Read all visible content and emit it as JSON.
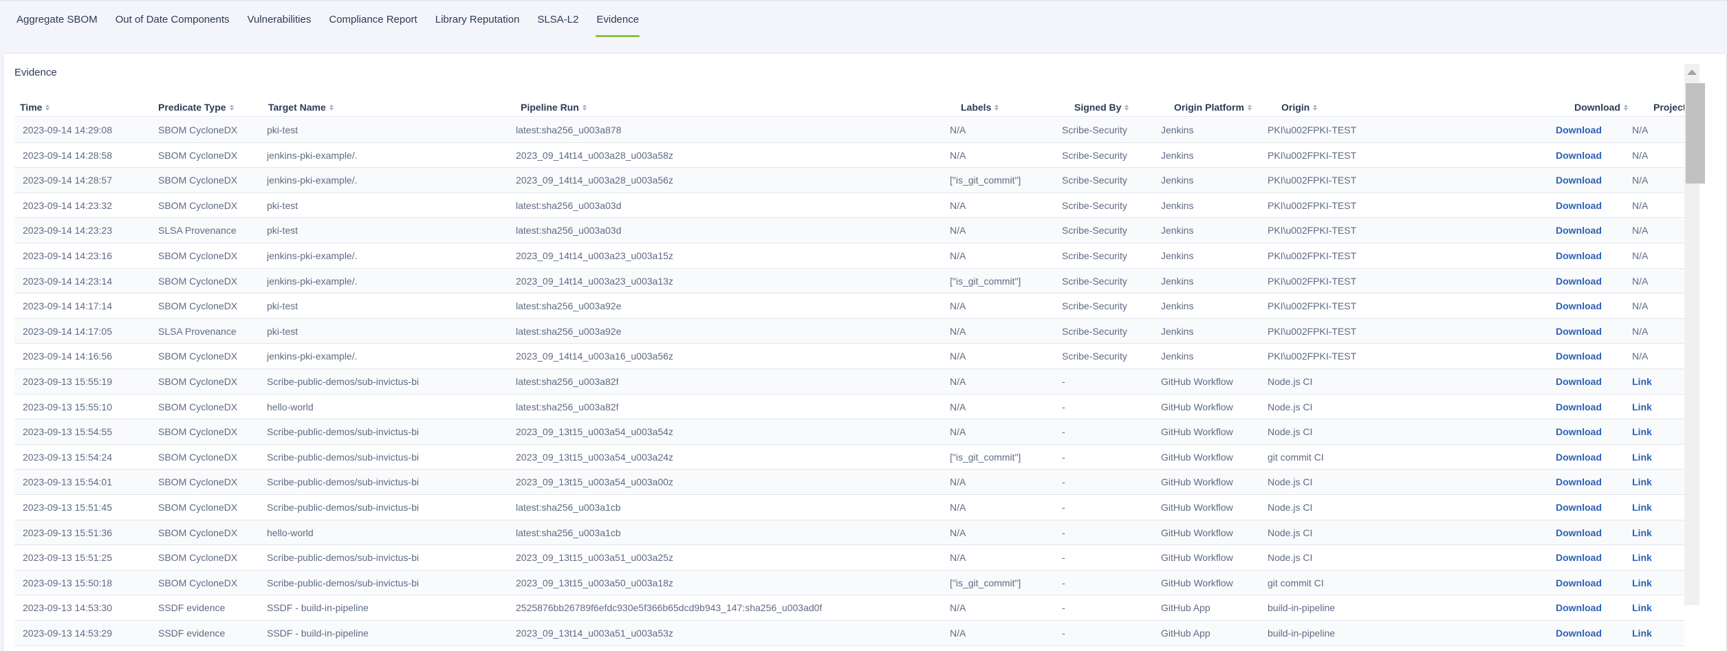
{
  "tabs": [
    {
      "label": "Aggregate SBOM",
      "active": false
    },
    {
      "label": "Out of Date Components",
      "active": false
    },
    {
      "label": "Vulnerabilities",
      "active": false
    },
    {
      "label": "Compliance Report",
      "active": false
    },
    {
      "label": "Library Reputation",
      "active": false
    },
    {
      "label": "SLSA-L2",
      "active": false
    },
    {
      "label": "Evidence",
      "active": true
    }
  ],
  "colors": {
    "accent": "#8cbf3f",
    "link": "#2a62b8"
  },
  "evidence": {
    "title": "Evidence",
    "columns": [
      {
        "key": "time",
        "label": "Time"
      },
      {
        "key": "predicate",
        "label": "Predicate Type"
      },
      {
        "key": "target",
        "label": "Target Name"
      },
      {
        "key": "pipeline",
        "label": "Pipeline Run"
      },
      {
        "key": "labels",
        "label": "Labels"
      },
      {
        "key": "signed",
        "label": "Signed By"
      },
      {
        "key": "platform",
        "label": "Origin Platform"
      },
      {
        "key": "origin",
        "label": "Origin"
      },
      {
        "key": "download",
        "label": "Download"
      },
      {
        "key": "project",
        "label": "Project"
      }
    ],
    "rows": [
      {
        "time": "2023-09-14 14:29:08",
        "predicate": "SBOM CycloneDX",
        "target": "pki-test",
        "pipeline": "latest:sha256_u003a878",
        "labels": "N/A",
        "signed": "Scribe-Security",
        "platform": "Jenkins",
        "origin": "PKI\\u002FPKI-TEST",
        "download": "Download",
        "project": "N/A"
      },
      {
        "time": "2023-09-14 14:28:58",
        "predicate": "SBOM CycloneDX",
        "target": "jenkins-pki-example/.",
        "pipeline": "2023_09_14t14_u003a28_u003a58z",
        "labels": "N/A",
        "signed": "Scribe-Security",
        "platform": "Jenkins",
        "origin": "PKI\\u002FPKI-TEST",
        "download": "Download",
        "project": "N/A"
      },
      {
        "time": "2023-09-14 14:28:57",
        "predicate": "SBOM CycloneDX",
        "target": "jenkins-pki-example/.",
        "pipeline": "2023_09_14t14_u003a28_u003a56z",
        "labels": "[\"is_git_commit\"]",
        "signed": "Scribe-Security",
        "platform": "Jenkins",
        "origin": "PKI\\u002FPKI-TEST",
        "download": "Download",
        "project": "N/A"
      },
      {
        "time": "2023-09-14 14:23:32",
        "predicate": "SBOM CycloneDX",
        "target": "pki-test",
        "pipeline": "latest:sha256_u003a03d",
        "labels": "N/A",
        "signed": "Scribe-Security",
        "platform": "Jenkins",
        "origin": "PKI\\u002FPKI-TEST",
        "download": "Download",
        "project": "N/A"
      },
      {
        "time": "2023-09-14 14:23:23",
        "predicate": "SLSA Provenance",
        "target": "pki-test",
        "pipeline": "latest:sha256_u003a03d",
        "labels": "N/A",
        "signed": "Scribe-Security",
        "platform": "Jenkins",
        "origin": "PKI\\u002FPKI-TEST",
        "download": "Download",
        "project": "N/A"
      },
      {
        "time": "2023-09-14 14:23:16",
        "predicate": "SBOM CycloneDX",
        "target": "jenkins-pki-example/.",
        "pipeline": "2023_09_14t14_u003a23_u003a15z",
        "labels": "N/A",
        "signed": "Scribe-Security",
        "platform": "Jenkins",
        "origin": "PKI\\u002FPKI-TEST",
        "download": "Download",
        "project": "N/A"
      },
      {
        "time": "2023-09-14 14:23:14",
        "predicate": "SBOM CycloneDX",
        "target": "jenkins-pki-example/.",
        "pipeline": "2023_09_14t14_u003a23_u003a13z",
        "labels": "[\"is_git_commit\"]",
        "signed": "Scribe-Security",
        "platform": "Jenkins",
        "origin": "PKI\\u002FPKI-TEST",
        "download": "Download",
        "project": "N/A"
      },
      {
        "time": "2023-09-14 14:17:14",
        "predicate": "SBOM CycloneDX",
        "target": "pki-test",
        "pipeline": "latest:sha256_u003a92e",
        "labels": "N/A",
        "signed": "Scribe-Security",
        "platform": "Jenkins",
        "origin": "PKI\\u002FPKI-TEST",
        "download": "Download",
        "project": "N/A"
      },
      {
        "time": "2023-09-14 14:17:05",
        "predicate": "SLSA Provenance",
        "target": "pki-test",
        "pipeline": "latest:sha256_u003a92e",
        "labels": "N/A",
        "signed": "Scribe-Security",
        "platform": "Jenkins",
        "origin": "PKI\\u002FPKI-TEST",
        "download": "Download",
        "project": "N/A"
      },
      {
        "time": "2023-09-14 14:16:56",
        "predicate": "SBOM CycloneDX",
        "target": "jenkins-pki-example/.",
        "pipeline": "2023_09_14t14_u003a16_u003a56z",
        "labels": "N/A",
        "signed": "Scribe-Security",
        "platform": "Jenkins",
        "origin": "PKI\\u002FPKI-TEST",
        "download": "Download",
        "project": "N/A"
      },
      {
        "time": "2023-09-13 15:55:19",
        "predicate": "SBOM CycloneDX",
        "target": "Scribe-public-demos/sub-invictus-bi",
        "pipeline": "latest:sha256_u003a82f",
        "labels": "N/A",
        "signed": "-",
        "platform": "GitHub Workflow",
        "origin": "Node.js CI",
        "download": "Download",
        "project": "Link"
      },
      {
        "time": "2023-09-13 15:55:10",
        "predicate": "SBOM CycloneDX",
        "target": "hello-world",
        "pipeline": "latest:sha256_u003a82f",
        "labels": "N/A",
        "signed": "-",
        "platform": "GitHub Workflow",
        "origin": "Node.js CI",
        "download": "Download",
        "project": "Link"
      },
      {
        "time": "2023-09-13 15:54:55",
        "predicate": "SBOM CycloneDX",
        "target": "Scribe-public-demos/sub-invictus-bi",
        "pipeline": "2023_09_13t15_u003a54_u003a54z",
        "labels": "N/A",
        "signed": "-",
        "platform": "GitHub Workflow",
        "origin": "Node.js CI",
        "download": "Download",
        "project": "Link"
      },
      {
        "time": "2023-09-13 15:54:24",
        "predicate": "SBOM CycloneDX",
        "target": "Scribe-public-demos/sub-invictus-bi",
        "pipeline": "2023_09_13t15_u003a54_u003a24z",
        "labels": "[\"is_git_commit\"]",
        "signed": "-",
        "platform": "GitHub Workflow",
        "origin": "git commit CI",
        "download": "Download",
        "project": "Link"
      },
      {
        "time": "2023-09-13 15:54:01",
        "predicate": "SBOM CycloneDX",
        "target": "Scribe-public-demos/sub-invictus-bi",
        "pipeline": "2023_09_13t15_u003a54_u003a00z",
        "labels": "N/A",
        "signed": "-",
        "platform": "GitHub Workflow",
        "origin": "Node.js CI",
        "download": "Download",
        "project": "Link"
      },
      {
        "time": "2023-09-13 15:51:45",
        "predicate": "SBOM CycloneDX",
        "target": "Scribe-public-demos/sub-invictus-bi",
        "pipeline": "latest:sha256_u003a1cb",
        "labels": "N/A",
        "signed": "-",
        "platform": "GitHub Workflow",
        "origin": "Node.js CI",
        "download": "Download",
        "project": "Link"
      },
      {
        "time": "2023-09-13 15:51:36",
        "predicate": "SBOM CycloneDX",
        "target": "hello-world",
        "pipeline": "latest:sha256_u003a1cb",
        "labels": "N/A",
        "signed": "-",
        "platform": "GitHub Workflow",
        "origin": "Node.js CI",
        "download": "Download",
        "project": "Link"
      },
      {
        "time": "2023-09-13 15:51:25",
        "predicate": "SBOM CycloneDX",
        "target": "Scribe-public-demos/sub-invictus-bi",
        "pipeline": "2023_09_13t15_u003a51_u003a25z",
        "labels": "N/A",
        "signed": "-",
        "platform": "GitHub Workflow",
        "origin": "Node.js CI",
        "download": "Download",
        "project": "Link"
      },
      {
        "time": "2023-09-13 15:50:18",
        "predicate": "SBOM CycloneDX",
        "target": "Scribe-public-demos/sub-invictus-bi",
        "pipeline": "2023_09_13t15_u003a50_u003a18z",
        "labels": "[\"is_git_commit\"]",
        "signed": "-",
        "platform": "GitHub Workflow",
        "origin": "git commit CI",
        "download": "Download",
        "project": "Link"
      },
      {
        "time": "2023-09-13 14:53:30",
        "predicate": "SSDF evidence",
        "target": "SSDF - build-in-pipeline",
        "pipeline": "2525876bb26789f6efdc930e5f366b65dcd9b943_147:sha256_u003ad0f",
        "labels": "N/A",
        "signed": "-",
        "platform": "GitHub App",
        "origin": "build-in-pipeline",
        "download": "Download",
        "project": "Link"
      },
      {
        "time": "2023-09-13 14:53:29",
        "predicate": "SSDF evidence",
        "target": "SSDF - build-in-pipeline",
        "pipeline": "2023_09_13t14_u003a51_u003a53z",
        "labels": "N/A",
        "signed": "-",
        "platform": "GitHub App",
        "origin": "build-in-pipeline",
        "download": "Download",
        "project": "Link"
      }
    ]
  }
}
